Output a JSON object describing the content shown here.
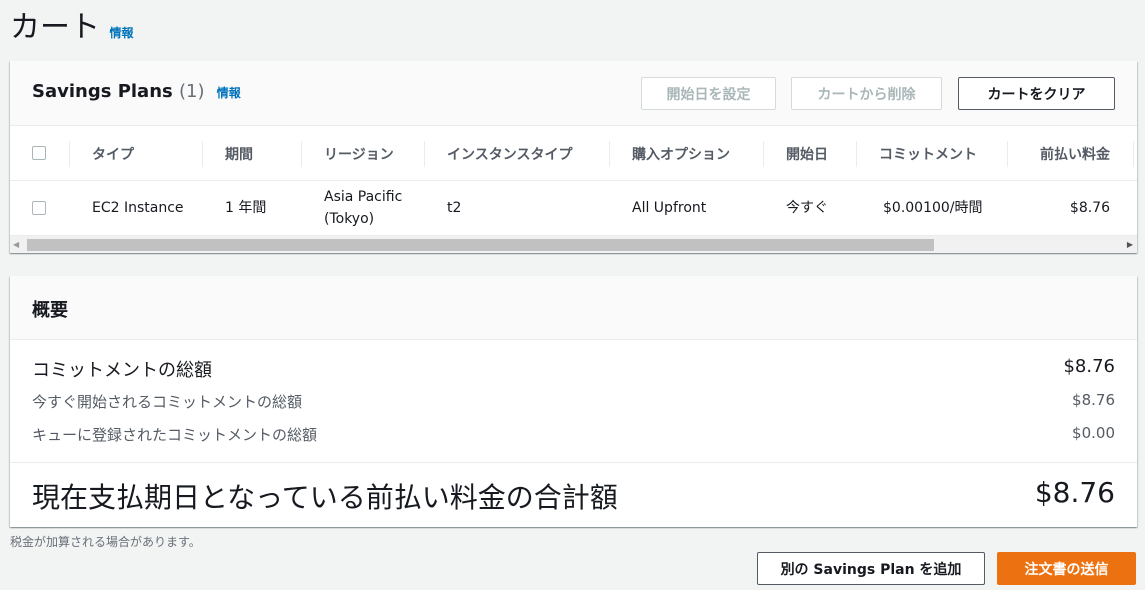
{
  "page": {
    "title": "カート",
    "info": "情報"
  },
  "cart": {
    "title": "Savings Plans",
    "count": "(1)",
    "info": "情報",
    "buttons": {
      "set_start": "開始日を設定",
      "remove": "カートから削除",
      "clear": "カートをクリア"
    },
    "columns": [
      "タイプ",
      "期間",
      "リージョン",
      "インスタンスタイプ",
      "購入オプション",
      "開始日",
      "コミットメント",
      "前払い料金"
    ],
    "rows": [
      {
        "type": "EC2 Instance",
        "term": "1 年間",
        "region_line1": "Asia Pacific",
        "region_line2": "(Tokyo)",
        "instance_type": "t2",
        "purchase_option": "All Upfront",
        "start": "今すぐ",
        "commitment": "$0.00100/時間",
        "upfront": "$8.76"
      }
    ]
  },
  "summary": {
    "title": "概要",
    "total_commitment": {
      "label": "コミットメントの総額",
      "value": "$8.76"
    },
    "immediate": {
      "label": "今すぐ開始されるコミットメントの総額",
      "value": "$8.76"
    },
    "queued": {
      "label": "キューに登録されたコミットメントの総額",
      "value": "$0.00"
    },
    "due": {
      "label": "現在支払期日となっている前払い料金の合計額",
      "value": "$8.76"
    }
  },
  "footer": {
    "tax_note": "税金が加算される場合があります。",
    "add_plan": "別の Savings Plan を追加",
    "submit": "注文書の送信"
  },
  "colors": {
    "accent": "#ec7211",
    "link": "#0073bb"
  }
}
